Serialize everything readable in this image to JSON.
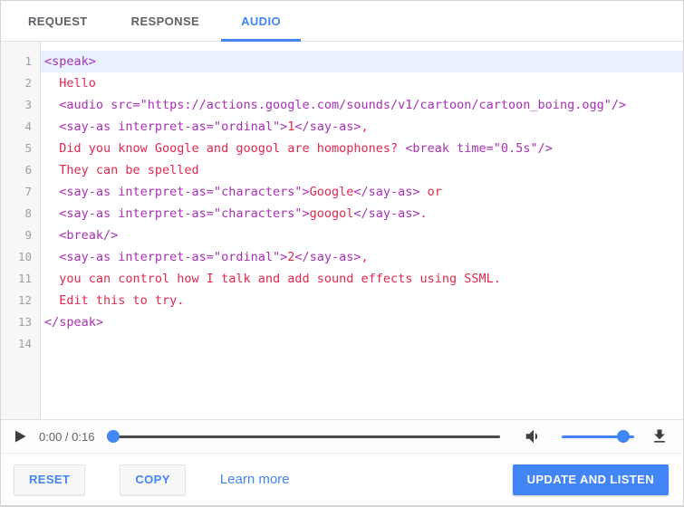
{
  "tabs": [
    {
      "label": "REQUEST",
      "active": false
    },
    {
      "label": "RESPONSE",
      "active": false
    },
    {
      "label": "AUDIO",
      "active": true
    }
  ],
  "editor": {
    "language": "ssml",
    "active_line": 1,
    "lines": [
      {
        "num": 1,
        "segments": [
          {
            "c": "tag",
            "t": "<speak>"
          }
        ]
      },
      {
        "num": 2,
        "segments": [
          {
            "c": "txt",
            "t": "  Hello"
          }
        ]
      },
      {
        "num": 3,
        "segments": [
          {
            "c": "tag",
            "t": "  <audio src=\"https://actions.google.com/sounds/v1/cartoon/cartoon_boing.ogg\"/>"
          }
        ]
      },
      {
        "num": 4,
        "segments": [
          {
            "c": "tag",
            "t": "  <say-as interpret-as=\"ordinal\">"
          },
          {
            "c": "txt",
            "t": "1"
          },
          {
            "c": "tag",
            "t": "</say-as>"
          },
          {
            "c": "txt",
            "t": ","
          }
        ]
      },
      {
        "num": 5,
        "segments": [
          {
            "c": "txt",
            "t": "  Did you know Google and googol are homophones? "
          },
          {
            "c": "tag",
            "t": "<break time=\"0.5s\"/>"
          }
        ]
      },
      {
        "num": 6,
        "segments": [
          {
            "c": "txt",
            "t": "  They can be spelled"
          }
        ]
      },
      {
        "num": 7,
        "segments": [
          {
            "c": "tag",
            "t": "  <say-as interpret-as=\"characters\">"
          },
          {
            "c": "txt",
            "t": "Google"
          },
          {
            "c": "tag",
            "t": "</say-as>"
          },
          {
            "c": "txt",
            "t": " or"
          }
        ]
      },
      {
        "num": 8,
        "segments": [
          {
            "c": "tag",
            "t": "  <say-as interpret-as=\"characters\">"
          },
          {
            "c": "txt",
            "t": "googol"
          },
          {
            "c": "tag",
            "t": "</say-as>"
          },
          {
            "c": "txt",
            "t": "."
          }
        ]
      },
      {
        "num": 9,
        "segments": [
          {
            "c": "tag",
            "t": "  <break/>"
          }
        ]
      },
      {
        "num": 10,
        "segments": [
          {
            "c": "tag",
            "t": "  <say-as interpret-as=\"ordinal\">"
          },
          {
            "c": "txt",
            "t": "2"
          },
          {
            "c": "tag",
            "t": "</say-as>"
          },
          {
            "c": "txt",
            "t": ","
          }
        ]
      },
      {
        "num": 11,
        "segments": [
          {
            "c": "txt",
            "t": "  you can control how I talk and add sound effects using SSML."
          }
        ]
      },
      {
        "num": 12,
        "segments": [
          {
            "c": "txt",
            "t": "  Edit this to try."
          }
        ]
      },
      {
        "num": 13,
        "segments": [
          {
            "c": "tag",
            "t": "</speak>"
          }
        ]
      },
      {
        "num": 14,
        "segments": []
      }
    ]
  },
  "player": {
    "time_display": "0:00 / 0:16",
    "seek_percent": 0,
    "volume_percent": 92,
    "icons": {
      "play": "play-icon",
      "volume": "volume-icon",
      "download": "download-icon"
    }
  },
  "footer": {
    "reset_label": "RESET",
    "copy_label": "COPY",
    "learn_more_label": "Learn more",
    "update_label": "UPDATE AND LISTEN"
  },
  "colors": {
    "accent": "#4285f4",
    "code_tag": "#a830b4",
    "code_text": "#e0284e",
    "active_line_bg": "#e8f1fd",
    "line_number": "#9aa0a6",
    "tab_inactive": "#5f6368",
    "seek_track": "#4a4a4a",
    "icon": "#3c4043"
  }
}
